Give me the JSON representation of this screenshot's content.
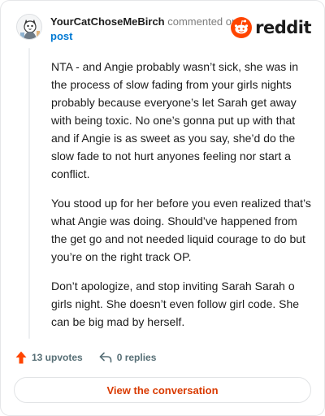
{
  "header": {
    "username": "YourCatChoseMeBirch",
    "action_text": " commented on ",
    "post_link": "post",
    "brand_name": "reddit"
  },
  "comment": {
    "paragraphs": [
      "NTA - and Angie probably wasn’t sick, she was in the process of slow fading from your girls nights probably because everyone’s let Sarah get away with being toxic. No one’s gonna put up with that and if Angie is as sweet as you say, she’d do the slow fade to not hurt anyones feeling nor start a conflict.",
      "You stood up for her before you even realized that’s what Angie was doing. Should’ve happened from the get go and not needed liquid courage to do but you’re on the right track OP.",
      "Don’t apologize, and stop inviting Sarah Sarah o girls night. She doesn’t even follow girl code. She can be big mad by herself."
    ]
  },
  "actions": {
    "upvotes": "13 upvotes",
    "replies": "0 replies"
  },
  "footer": {
    "view_button": "View the conversation"
  },
  "colors": {
    "brand": "#ff4500",
    "upvote": "#ff4500",
    "button_text": "#d93a00",
    "link": "#0079d3"
  },
  "icons": {
    "brand": "reddit-logo-icon",
    "upvote": "upvote-arrow-icon",
    "reply": "reply-arrow-icon",
    "avatar": "cat-avatar-icon"
  }
}
